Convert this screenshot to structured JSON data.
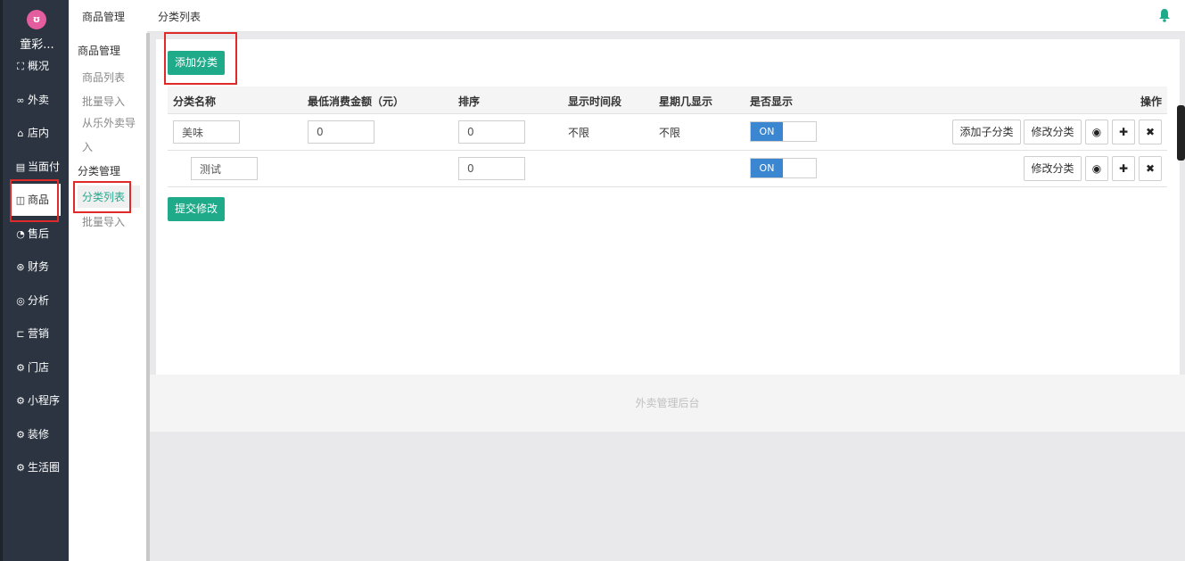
{
  "sidebar": {
    "logo_glyph": "ʊ",
    "shop_name": "童彩...",
    "items": [
      {
        "icon": "dashboard-icon",
        "glyph": "⛶",
        "label": "概况"
      },
      {
        "icon": "delivery-icon",
        "glyph": "∞",
        "label": "外卖"
      },
      {
        "icon": "store-icon",
        "glyph": "⌂",
        "label": "店内"
      },
      {
        "icon": "receipt-icon",
        "glyph": "▤",
        "label": "当面付"
      },
      {
        "icon": "bag-icon",
        "glyph": "◫",
        "label": "商品"
      },
      {
        "icon": "aftersale-icon",
        "glyph": "◔",
        "label": "售后"
      },
      {
        "icon": "finance-icon",
        "glyph": "⊛",
        "label": "财务"
      },
      {
        "icon": "analytics-icon",
        "glyph": "◎",
        "label": "分析"
      },
      {
        "icon": "marketing-icon",
        "glyph": "⊏",
        "label": "营销"
      },
      {
        "icon": "gear-icon",
        "glyph": "⚙",
        "label": "门店"
      },
      {
        "icon": "gear-icon",
        "glyph": "⚙",
        "label": "小程序"
      },
      {
        "icon": "gear-icon",
        "glyph": "⚙",
        "label": "装修"
      },
      {
        "icon": "gear-icon",
        "glyph": "⚙",
        "label": "生活圈"
      }
    ]
  },
  "subbar": {
    "title": "商品管理",
    "group1": "商品管理",
    "group1_links": [
      "商品列表",
      "批量导入",
      "从乐外卖导入"
    ],
    "group2": "分类管理",
    "group2_links": [
      "分类列表",
      "批量导入"
    ]
  },
  "header": {
    "title": "分类列表"
  },
  "main": {
    "add_button": "添加分类",
    "submit_button": "提交修改",
    "columns": [
      "分类名称",
      "最低消费金额（元）",
      "排序",
      "显示时间段",
      "星期几显示",
      "是否显示",
      "操作"
    ],
    "rows": [
      {
        "name": "美味",
        "min_amount": "0",
        "sort": "0",
        "time_range": "不限",
        "weekday": "不限",
        "toggle": "ON",
        "add_child": "添加子分类",
        "edit": "修改分类"
      },
      {
        "name": "测试",
        "sort": "0",
        "toggle": "ON",
        "edit": "修改分类"
      }
    ]
  },
  "footer": {
    "text": "外卖管理后台"
  },
  "colors": {
    "accent_green": "#1fab89",
    "toggle_blue": "#3a86d0",
    "sidebar_dark": "#2b3440",
    "highlight_red": "#e02a2a"
  }
}
